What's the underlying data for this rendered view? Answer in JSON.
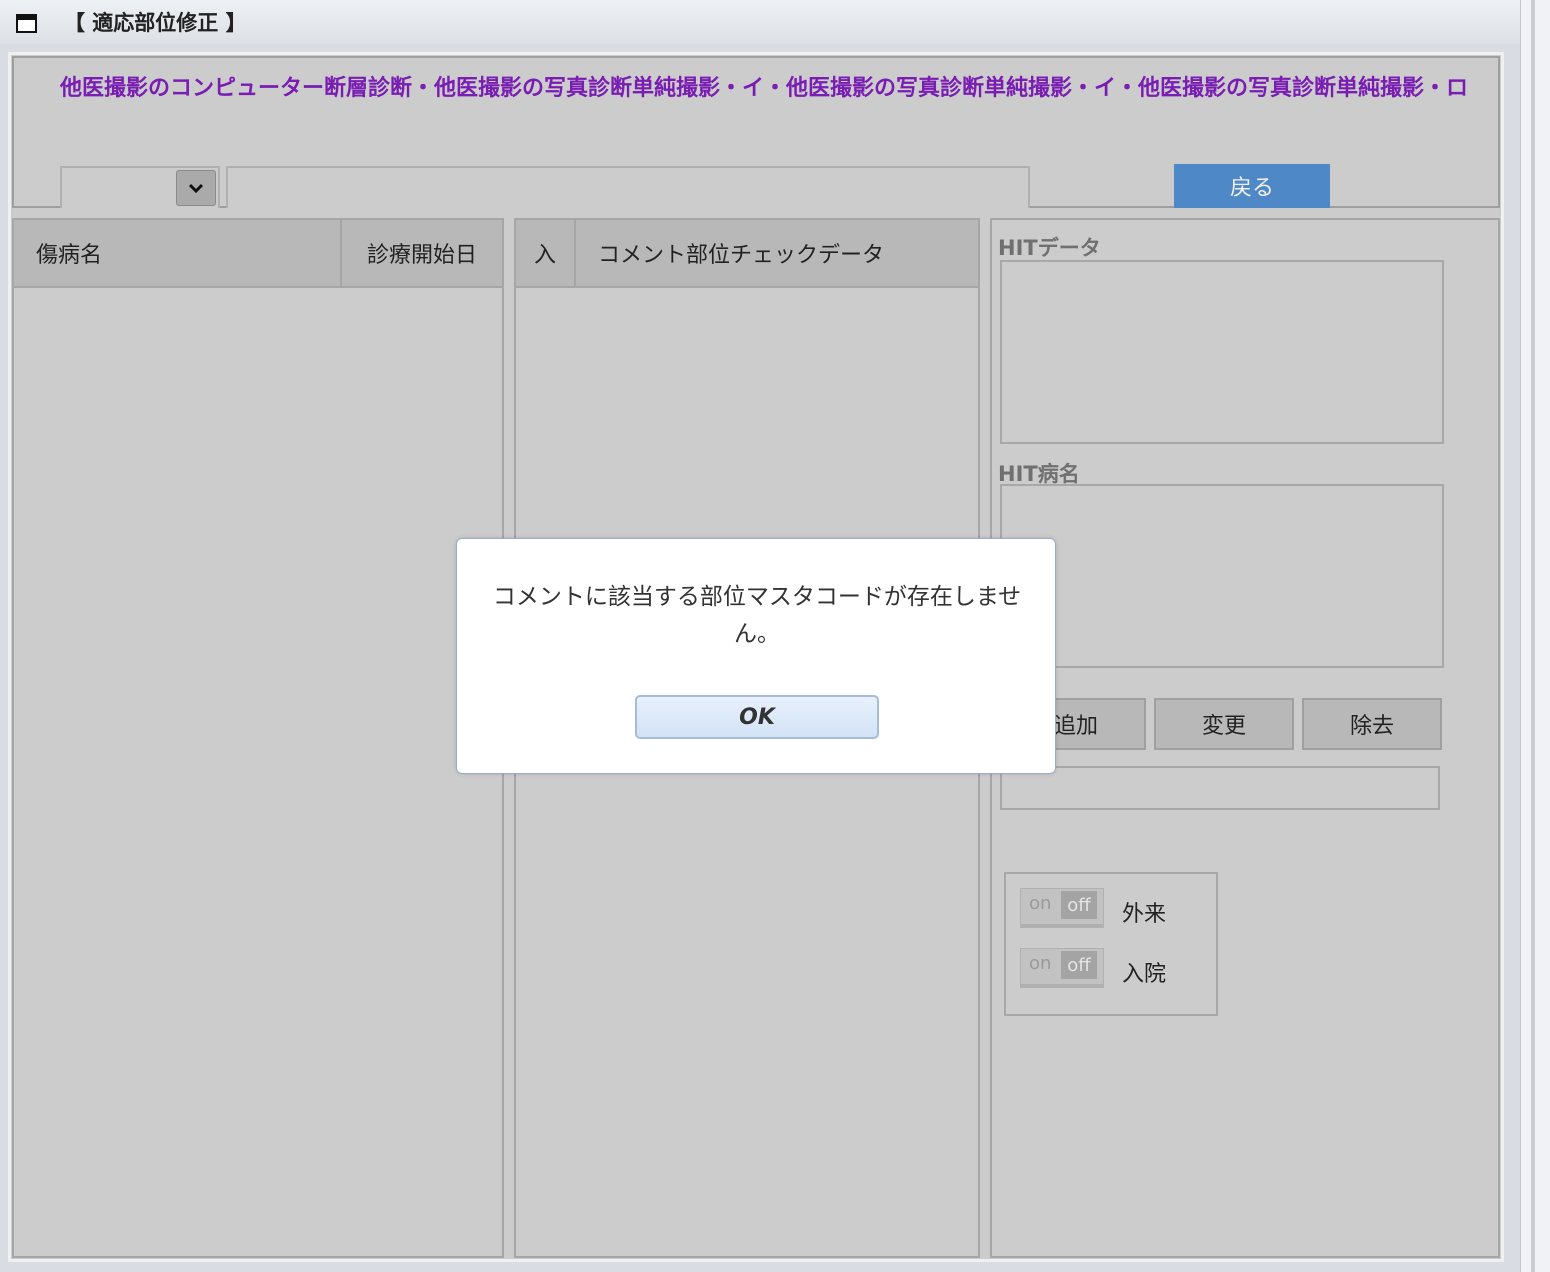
{
  "window": {
    "title": "【 適応部位修正 】"
  },
  "header": {
    "diagnosis_title": "他医撮影のコンピューター断層診断・他医撮影の写真診断単純撮影・イ・他医撮影の写真診断単純撮影・イ・他医撮影の写真診断単純撮影・ロ",
    "select_value": "",
    "text_value": "",
    "back_label": "戻る"
  },
  "disease_grid": {
    "columns": [
      "傷病名",
      "診療開始日"
    ],
    "rows": []
  },
  "comment_grid": {
    "columns": [
      "入",
      "コメント部位チェックデータ"
    ],
    "rows": []
  },
  "side_panel": {
    "hit_data_label": "HITデータ",
    "hit_disease_label": "HIT病名",
    "buttons": {
      "add": "追加",
      "change": "変更",
      "remove": "除去"
    },
    "input_value": "",
    "toggles": [
      {
        "on": "on",
        "off": "off",
        "label": "外来",
        "state": "off"
      },
      {
        "on": "on",
        "off": "off",
        "label": "入院",
        "state": "off"
      }
    ]
  },
  "dialog": {
    "message": "コメントに該当する部位マスタコードが存在しません。",
    "ok_label": "OK"
  },
  "colors": {
    "title_purple": "#7a1db3",
    "back_button_blue": "#4f88c6",
    "panel_gray": "#cccccc"
  }
}
